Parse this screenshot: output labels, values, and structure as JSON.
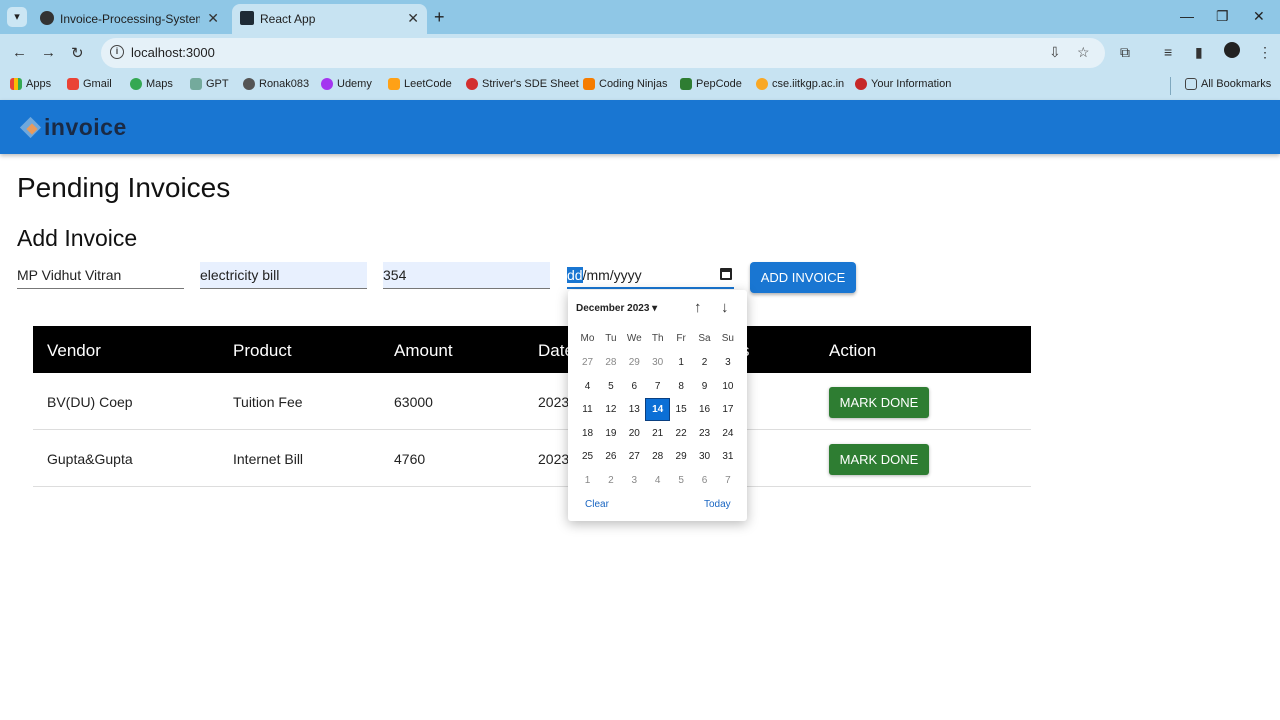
{
  "browser": {
    "tabs": [
      {
        "title": "Invoice-Processing-System/ at",
        "active": false
      },
      {
        "title": "React App",
        "active": true
      }
    ],
    "url": "localhost:3000",
    "bookmarks": [
      "Apps",
      "Gmail",
      "Maps",
      "GPT",
      "Ronak083",
      "Udemy",
      "LeetCode",
      "Striver's SDE Sheet",
      "Coding Ninjas",
      "PepCode",
      "cse.iitkgp.ac.in",
      "Your Information"
    ],
    "all_bookmarks": "All Bookmarks"
  },
  "app": {
    "logo_text": "invoice",
    "page_title": "Pending Invoices",
    "section_title": "Add Invoice",
    "form": {
      "vendor": "MP Vidhut Vitran",
      "product": "electricity bill",
      "amount": "354",
      "date_dd": "dd",
      "date_rest": "/mm/yyyy",
      "add_label": "ADD INVOICE"
    },
    "table": {
      "headers": [
        "Vendor",
        "Product",
        "Amount",
        "Date",
        "s",
        "Action"
      ],
      "rows": [
        {
          "vendor": "BV(DU) Coep",
          "product": "Tuition Fee",
          "amount": "63000",
          "date": "2023",
          "action": "MARK DONE"
        },
        {
          "vendor": "Gupta&Gupta",
          "product": "Internet Bill",
          "amount": "4760",
          "date": "2023",
          "action": "MARK DONE"
        }
      ]
    }
  },
  "datepicker": {
    "month": "December 2023",
    "weekdays": [
      "Mo",
      "Tu",
      "We",
      "Th",
      "Fr",
      "Sa",
      "Su"
    ],
    "weeks": [
      [
        "27",
        "28",
        "29",
        "30",
        "1",
        "2",
        "3"
      ],
      [
        "4",
        "5",
        "6",
        "7",
        "8",
        "9",
        "10"
      ],
      [
        "11",
        "12",
        "13",
        "14",
        "15",
        "16",
        "17"
      ],
      [
        "18",
        "19",
        "20",
        "21",
        "22",
        "23",
        "24"
      ],
      [
        "25",
        "26",
        "27",
        "28",
        "29",
        "30",
        "31"
      ],
      [
        "1",
        "2",
        "3",
        "4",
        "5",
        "6",
        "7"
      ]
    ],
    "selected": "14",
    "clear": "Clear",
    "today": "Today"
  },
  "colors": {
    "appbar": "#1976d2",
    "done": "#2e7d32",
    "header": "#000000"
  }
}
